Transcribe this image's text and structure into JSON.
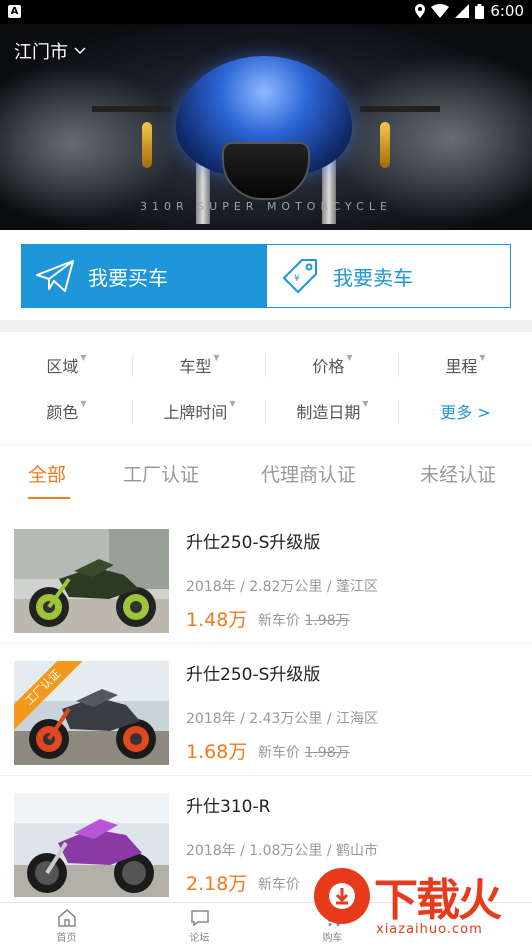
{
  "status_bar": {
    "time": "6:00",
    "app_icon": "A"
  },
  "header": {
    "city": "江门市"
  },
  "hero": {
    "caption": "310R SUPER MOTORCYCLE"
  },
  "actions": {
    "buy_label": "我要买车",
    "sell_label": "我要卖车"
  },
  "filters": {
    "row1": [
      "区域",
      "车型",
      "价格",
      "里程"
    ],
    "row2": [
      "颜色",
      "上牌时间",
      "制造日期"
    ],
    "more_label": "更多 >"
  },
  "tabs": [
    "全部",
    "工厂认证",
    "代理商认证",
    "未经认证"
  ],
  "listings": [
    {
      "title": "升仕250-S升级版",
      "meta": "2018年 / 2.82万公里 / 蓬江区",
      "price": "1.48万",
      "new_price_label": "新车价",
      "new_price": "1.98万",
      "badge": ""
    },
    {
      "title": "升仕250-S升级版",
      "meta": "2018年 / 2.43万公里 / 江海区",
      "price": "1.68万",
      "new_price_label": "新车价",
      "new_price": "1.98万",
      "badge": "工厂认证"
    },
    {
      "title": "升仕310-R",
      "meta": "2018年 / 1.08万公里 / 鹤山市",
      "price": "2.18万",
      "new_price_label": "新车价",
      "new_price": "",
      "badge": ""
    }
  ],
  "nav": [
    "首页",
    "论坛",
    "购车"
  ],
  "watermark": {
    "brand": "下载火",
    "url": "xiazaihuo.com"
  },
  "colors": {
    "accent": "#1e96d9",
    "price": "#f07a1e",
    "badge": "#f39a1e",
    "watermark": "#e63a1a"
  }
}
